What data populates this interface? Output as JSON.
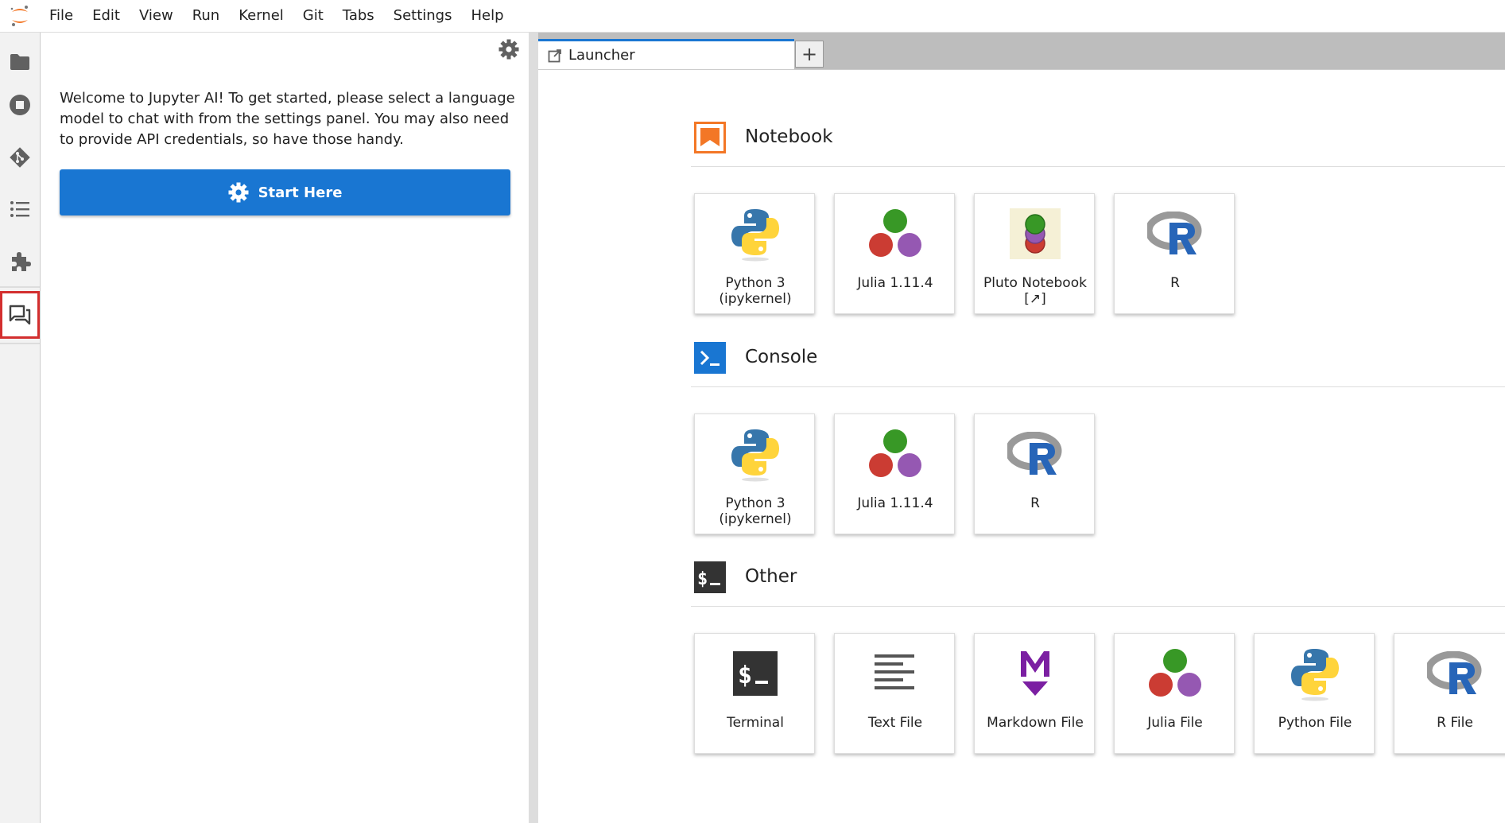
{
  "menubar": {
    "items": [
      "File",
      "Edit",
      "View",
      "Run",
      "Kernel",
      "Git",
      "Tabs",
      "Settings",
      "Help"
    ]
  },
  "iconbar": {
    "items": [
      {
        "name": "folder-icon"
      },
      {
        "name": "running-icon"
      },
      {
        "name": "git-icon"
      },
      {
        "name": "toc-icon"
      },
      {
        "name": "extension-icon"
      },
      {
        "name": "chat-icon",
        "selected": true
      }
    ]
  },
  "chat_panel": {
    "welcome": "Welcome to Jupyter AI! To get started, please select a language model to chat with from the settings panel. You may also need to provide API credentials, so have those handy.",
    "start_button": "Start Here"
  },
  "tabs": [
    {
      "label": "Launcher"
    }
  ],
  "tab_add_symbol": "+",
  "launcher": {
    "sections": [
      {
        "title": "Notebook",
        "cards": [
          {
            "label": "Python 3\n(ipykernel)",
            "icon": "python-icon"
          },
          {
            "label": "Julia 1.11.4",
            "icon": "julia-icon"
          },
          {
            "label": "Pluto Notebook\n[↗]",
            "icon": "pluto-icon"
          },
          {
            "label": "R",
            "icon": "r-icon"
          }
        ]
      },
      {
        "title": "Console",
        "cards": [
          {
            "label": "Python 3\n(ipykernel)",
            "icon": "python-icon"
          },
          {
            "label": "Julia 1.11.4",
            "icon": "julia-icon"
          },
          {
            "label": "R",
            "icon": "r-icon"
          }
        ]
      },
      {
        "title": "Other",
        "cards": [
          {
            "label": "Terminal",
            "icon": "terminal-icon"
          },
          {
            "label": "Text File",
            "icon": "text-file-icon"
          },
          {
            "label": "Markdown File",
            "icon": "markdown-icon"
          },
          {
            "label": "Julia File",
            "icon": "julia-icon"
          },
          {
            "label": "Python File",
            "icon": "python-icon"
          },
          {
            "label": "R File",
            "icon": "r-icon"
          }
        ]
      }
    ]
  },
  "colors": {
    "accent": "#1976d2",
    "orange": "#f37726",
    "selected_border": "#d32f2f"
  }
}
